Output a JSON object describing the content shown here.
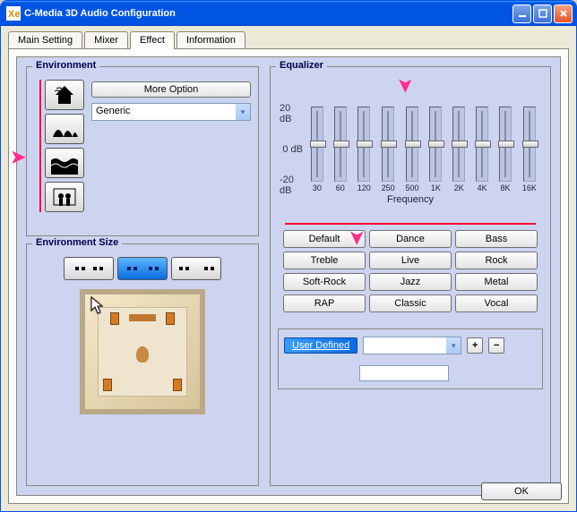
{
  "window": {
    "title": "C-Media 3D Audio Configuration"
  },
  "tabs": [
    "Main Setting",
    "Mixer",
    "Effect",
    "Information"
  ],
  "active_tab": 2,
  "environment": {
    "title": "Environment",
    "more_option": "More Option",
    "preset_select": "Generic",
    "icons": [
      "bathroom-icon",
      "operahouse-icon",
      "underwater-icon",
      "hallway-icon"
    ]
  },
  "environment_size": {
    "title": "Environment Size",
    "options": [
      "small",
      "medium",
      "large"
    ],
    "active": 1
  },
  "equalizer": {
    "title": "Equalizer",
    "y_ticks": [
      "20 dB",
      "0 dB",
      "-20 dB"
    ],
    "freqs": [
      "30",
      "60",
      "120",
      "250",
      "500",
      "1K",
      "2K",
      "4K",
      "8K",
      "16K"
    ],
    "freq_caption": "Frequency",
    "presets": [
      "Default",
      "Dance",
      "Bass",
      "Treble",
      "Live",
      "Rock",
      "Soft-Rock",
      "Jazz",
      "Metal",
      "RAP",
      "Classic",
      "Vocal"
    ],
    "user_defined_label": "User  Defined",
    "plus": "+",
    "minus": "−"
  },
  "footer": {
    "ok": "OK"
  },
  "chart_data": {
    "type": "bar",
    "title": "Equalizer",
    "xlabel": "Frequency",
    "ylabel": "dB",
    "ylim": [
      -20,
      20
    ],
    "categories": [
      "30",
      "60",
      "120",
      "250",
      "500",
      "1K",
      "2K",
      "4K",
      "8K",
      "16K"
    ],
    "values": [
      0,
      0,
      0,
      0,
      0,
      0,
      0,
      0,
      0,
      0
    ]
  }
}
